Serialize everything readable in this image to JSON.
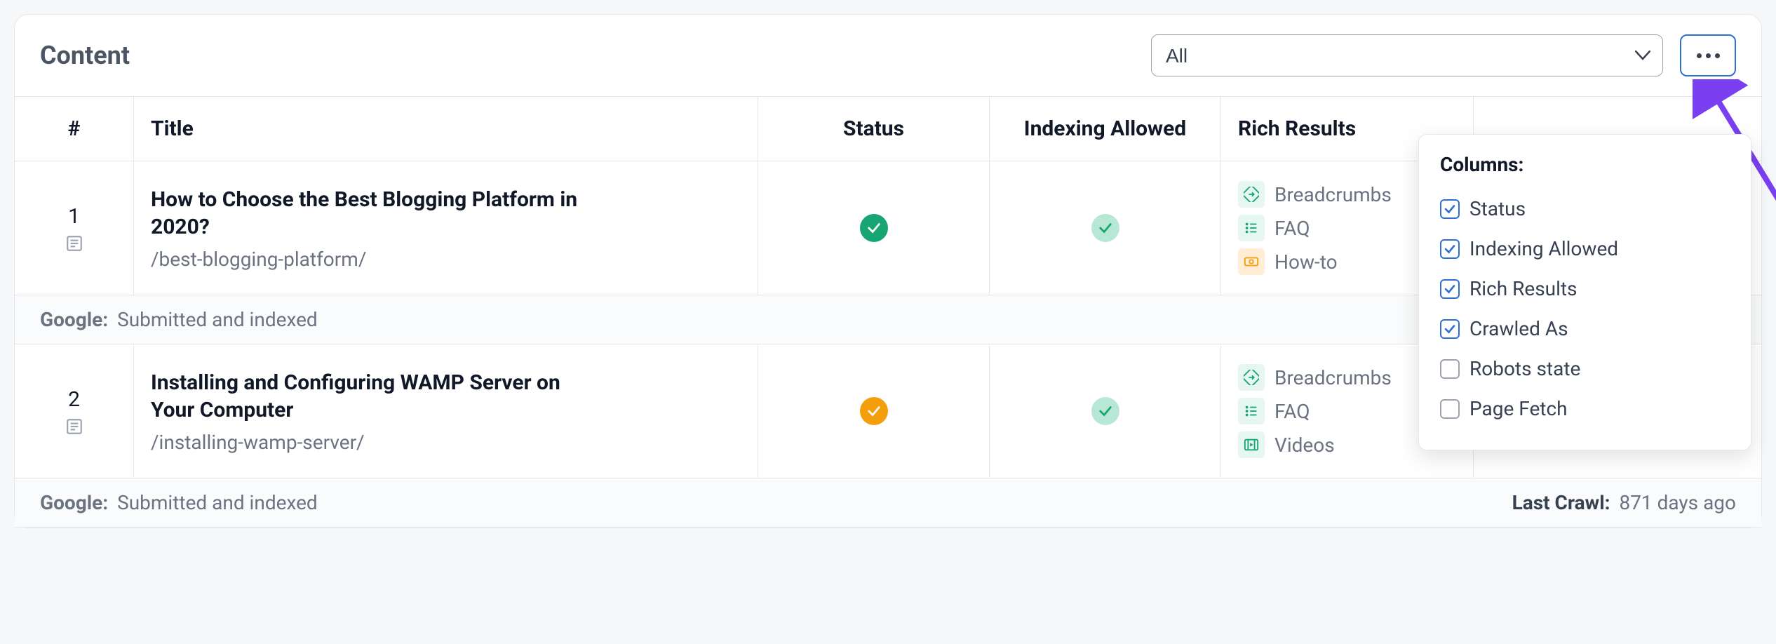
{
  "header": {
    "title": "Content",
    "filter_value": "All"
  },
  "columns": {
    "num": "#",
    "title": "Title",
    "status": "Status",
    "indexing": "Indexing Allowed",
    "rich": "Rich Results"
  },
  "rows": [
    {
      "num": "1",
      "title": "How to Choose the Best Blogging Platform in 2020?",
      "path": "/best-blogging-platform/",
      "status_color": "green-solid",
      "indexing_color": "green-light",
      "rich": [
        {
          "icon": "breadcrumb",
          "label": "Breadcrumbs"
        },
        {
          "icon": "faq",
          "label": "FAQ"
        },
        {
          "icon": "howto",
          "label": "How-to"
        }
      ],
      "google_label": "Google:",
      "google_status": "Submitted and indexed",
      "last_crawl_label": "",
      "last_crawl_value": ""
    },
    {
      "num": "2",
      "title": "Installing and Configuring WAMP Server on Your Computer",
      "path": "/installing-wamp-server/",
      "status_color": "orange",
      "indexing_color": "green-light",
      "rich": [
        {
          "icon": "breadcrumb",
          "label": "Breadcrumbs"
        },
        {
          "icon": "faq",
          "label": "FAQ"
        },
        {
          "icon": "videos",
          "label": "Videos"
        }
      ],
      "google_label": "Google:",
      "google_status": "Submitted and indexed",
      "last_crawl_label": "Last Crawl:",
      "last_crawl_value": "871 days ago"
    }
  ],
  "popover": {
    "title": "Columns:",
    "items": [
      {
        "label": "Status",
        "checked": true
      },
      {
        "label": "Indexing Allowed",
        "checked": true
      },
      {
        "label": "Rich Results",
        "checked": true
      },
      {
        "label": "Crawled As",
        "checked": true
      },
      {
        "label": "Robots state",
        "checked": false
      },
      {
        "label": "Page Fetch",
        "checked": false
      }
    ]
  }
}
